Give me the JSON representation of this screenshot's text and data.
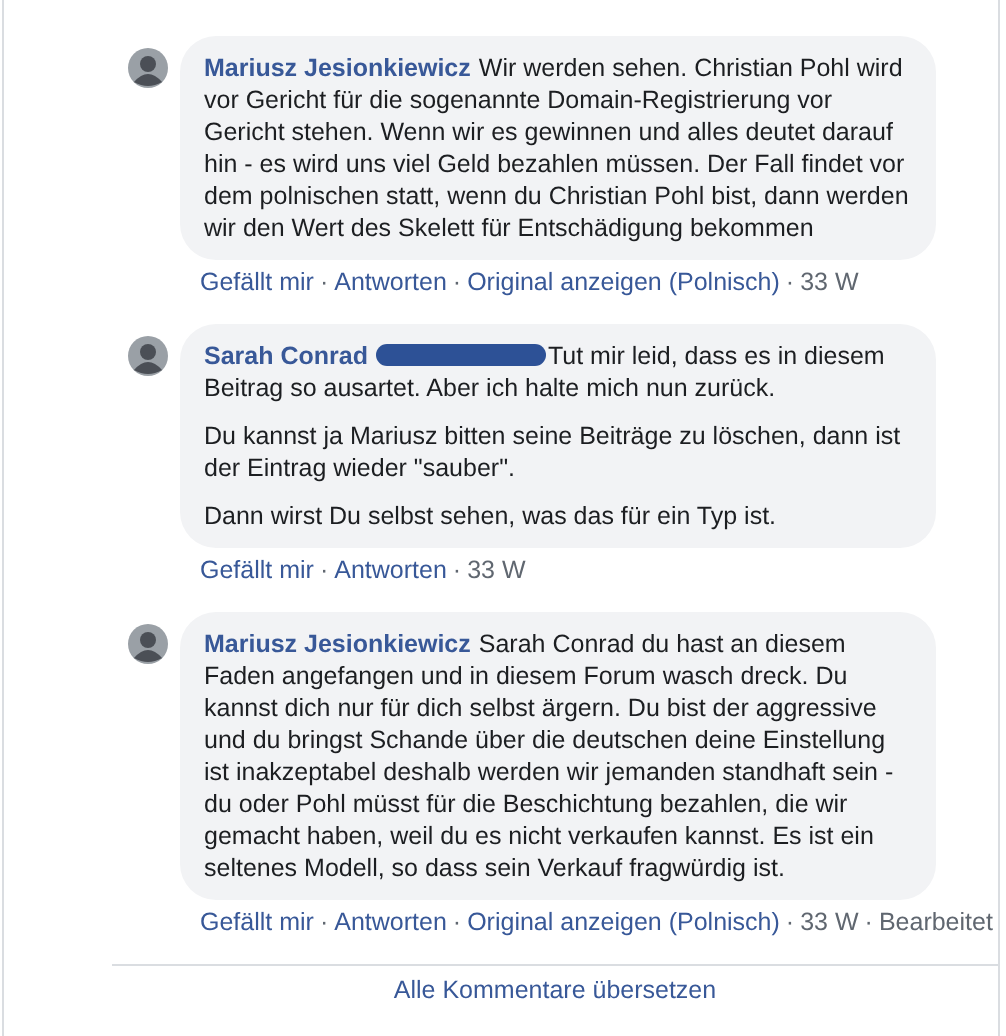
{
  "separator": "·",
  "comments": [
    {
      "author": "Mariusz Jesionkiewicz",
      "name_redacted": false,
      "paragraphs": [
        "Wir werden sehen. Christian Pohl wird vor Gericht für die sogenannte Domain-Registrierung vor Gericht stehen. Wenn wir es gewinnen und alles deutet darauf hin - es wird uns viel Geld bezahlen müssen. Der Fall findet vor dem polnischen statt, wenn du Christian Pohl bist, dann werden wir den Wert des Skelett für Entschädigung bekommen"
      ],
      "actions": [
        {
          "kind": "link",
          "text": "Gefällt mir"
        },
        {
          "kind": "link",
          "text": "Antworten"
        },
        {
          "kind": "link",
          "text": "Original anzeigen (Polnisch)"
        },
        {
          "kind": "meta",
          "text": "33 W"
        }
      ]
    },
    {
      "author": "Sarah Conrad",
      "name_redacted": true,
      "paragraphs": [
        "Tut mir leid, dass es in diesem Beitrag so ausartet. Aber ich halte mich nun zurück.",
        "Du kannst ja Mariusz bitten seine Beiträge zu löschen, dann ist der Eintrag wieder \"sauber\".",
        "Dann wirst Du selbst sehen, was das für ein Typ ist."
      ],
      "actions": [
        {
          "kind": "link",
          "text": "Gefällt mir"
        },
        {
          "kind": "link",
          "text": "Antworten"
        },
        {
          "kind": "meta",
          "text": "33 W"
        }
      ]
    },
    {
      "author": "Mariusz Jesionkiewicz",
      "name_redacted": false,
      "paragraphs": [
        "Sarah Conrad du hast an diesem Faden angefangen und in diesem Forum wasch dreck. Du kannst dich nur für dich selbst ärgern. Du bist der aggressive und du bringst Schande über die deutschen deine Einstellung ist inakzeptabel deshalb werden wir jemanden standhaft sein - du oder Pohl müsst für die Beschichtung bezahlen, die wir gemacht haben, weil du es nicht verkaufen kannst. Es ist ein seltenes Modell, so dass sein Verkauf fragwürdig ist."
      ],
      "actions": [
        {
          "kind": "link",
          "text": "Gefällt mir"
        },
        {
          "kind": "link",
          "text": "Antworten"
        },
        {
          "kind": "link",
          "text": "Original anzeigen (Polnisch)"
        },
        {
          "kind": "meta",
          "text": "33 W"
        },
        {
          "kind": "meta",
          "text": "Bearbeitet"
        }
      ]
    }
  ],
  "footer_link": "Alle Kommentare übersetzen"
}
